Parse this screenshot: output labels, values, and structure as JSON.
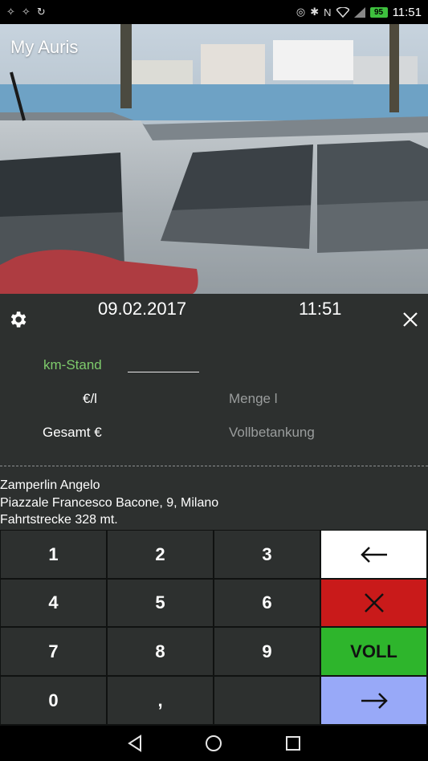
{
  "status_bar": {
    "left_icons": [
      "usb-icon",
      "usb-icon",
      "sync-icon"
    ],
    "right_icons": [
      "location-icon",
      "bluetooth-icon",
      "nfc-icon",
      "wifi-icon",
      "signal-icon"
    ],
    "battery": "95",
    "time": "11:51"
  },
  "app": {
    "title": "My Auris"
  },
  "panel": {
    "date": "09.02.2017",
    "time": "11:51",
    "km_label": "km-Stand",
    "km_value": "",
    "price_label": "€/l",
    "qty_placeholder": "Menge l",
    "total_label": "Gesamt €",
    "full_label": "Vollbetankung",
    "address": {
      "name": "Zamperlin Angelo",
      "street": "Piazzale Francesco Bacone, 9, Milano",
      "distance": "Fahrtstrecke 328  mt."
    }
  },
  "keypad": {
    "digits": [
      "1",
      "2",
      "3",
      "4",
      "5",
      "6",
      "7",
      "8",
      "9",
      "0",
      ","
    ],
    "backspace_icon": "arrow-left-icon",
    "clear_icon": "x-icon",
    "full_label": "VOLL",
    "next_icon": "arrow-right-icon"
  },
  "colors": {
    "panel_bg": "#2d302f",
    "accent_green_text": "#7ecb6c",
    "backspace_bg": "#ffffff",
    "clear_bg": "#c91a1a",
    "full_bg": "#2eb52c",
    "next_bg": "#98a9f8"
  },
  "nav_bar": {
    "icons": [
      "back-icon",
      "home-icon",
      "recents-icon"
    ]
  }
}
